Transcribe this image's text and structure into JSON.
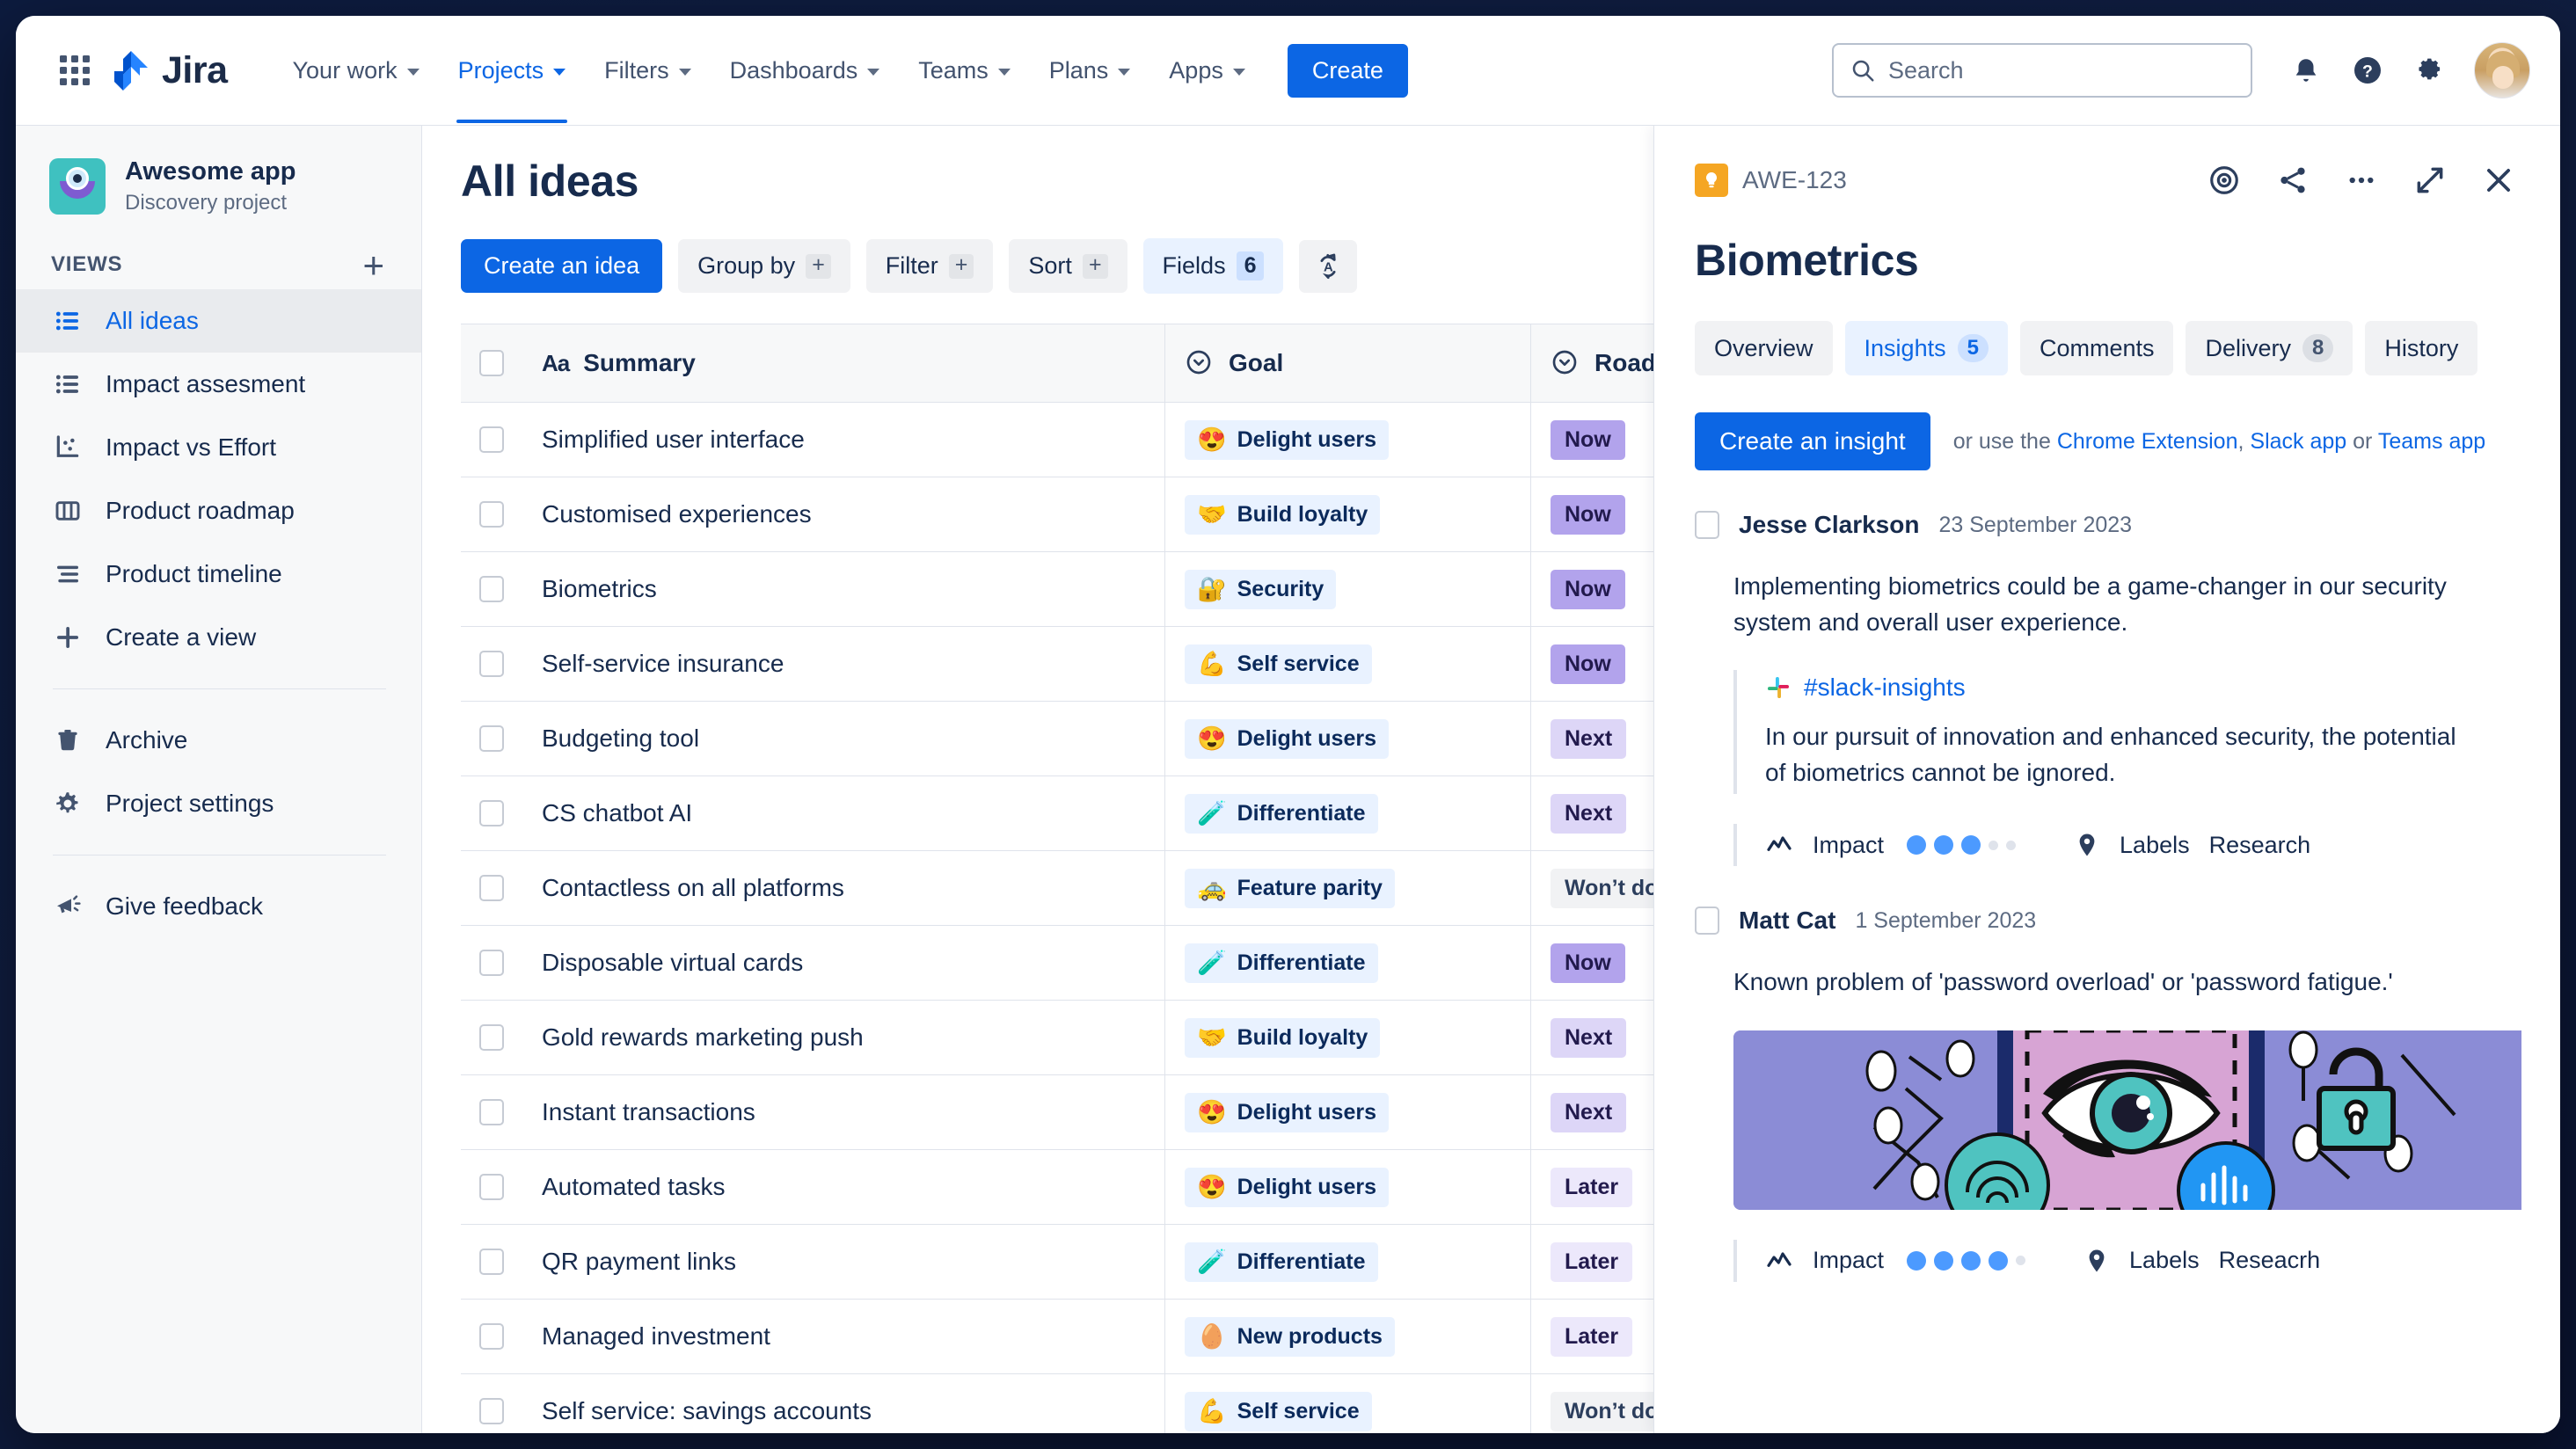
{
  "topnav": {
    "brand": "Jira",
    "app_switcher_name": "apps-grid-icon",
    "items": [
      {
        "label": "Your work",
        "active": false
      },
      {
        "label": "Projects",
        "active": true
      },
      {
        "label": "Filters",
        "active": false
      },
      {
        "label": "Dashboards",
        "active": false
      },
      {
        "label": "Teams",
        "active": false
      },
      {
        "label": "Plans",
        "active": false
      },
      {
        "label": "Apps",
        "active": false
      }
    ],
    "create_label": "Create",
    "search_placeholder": "Search",
    "icons": [
      "notifications-icon",
      "help-icon",
      "settings-icon",
      "avatar"
    ]
  },
  "sidebar": {
    "project_name": "Awesome app",
    "project_type": "Discovery project",
    "section_label": "VIEWS",
    "add_view_label": "+",
    "views": [
      {
        "label": "All ideas",
        "icon": "list-icon",
        "selected": true
      },
      {
        "label": "Impact assesment",
        "icon": "list-icon",
        "selected": false
      },
      {
        "label": "Impact vs Effort",
        "icon": "scatter-chart-icon",
        "selected": false
      },
      {
        "label": "Product roadmap",
        "icon": "board-columns-icon",
        "selected": false
      },
      {
        "label": "Product timeline",
        "icon": "timeline-icon",
        "selected": false
      },
      {
        "label": "Create a view",
        "icon": "plus-icon",
        "selected": false
      }
    ],
    "secondary": [
      {
        "label": "Archive",
        "icon": "trash-icon"
      },
      {
        "label": "Project settings",
        "icon": "gear-icon"
      }
    ],
    "feedback": {
      "label": "Give feedback",
      "icon": "megaphone-icon"
    }
  },
  "main": {
    "page_title": "All ideas",
    "toolbar": {
      "create_idea": "Create an idea",
      "group_by": "Group by",
      "group_by_plus": "+",
      "filter": "Filter",
      "filter_plus": "+",
      "sort": "Sort",
      "sort_plus": "+",
      "fields": "Fields",
      "fields_count": "6",
      "autosort_icon": "auto-sort-az-icon"
    },
    "table": {
      "columns": [
        {
          "label": "Summary",
          "icon": "text-aa-icon"
        },
        {
          "label": "Goal",
          "icon": "select-chevron-circle-icon"
        },
        {
          "label": "Roadm",
          "icon": "select-chevron-circle-icon"
        }
      ],
      "rows": [
        {
          "summary": "Simplified user interface",
          "goal": "Delight users",
          "goal_emoji": "😍",
          "roadmap": "Now",
          "roadmap_style": "now"
        },
        {
          "summary": "Customised experiences",
          "goal": "Build loyalty",
          "goal_emoji": "🤝",
          "roadmap": "Now",
          "roadmap_style": "now"
        },
        {
          "summary": "Biometrics",
          "goal": "Security",
          "goal_emoji": "🔐",
          "roadmap": "Now",
          "roadmap_style": "now"
        },
        {
          "summary": "Self-service insurance",
          "goal": "Self service",
          "goal_emoji": "💪",
          "roadmap": "Now",
          "roadmap_style": "now"
        },
        {
          "summary": "Budgeting tool",
          "goal": "Delight users",
          "goal_emoji": "😍",
          "roadmap": "Next",
          "roadmap_style": "next"
        },
        {
          "summary": "CS chatbot AI",
          "goal": "Differentiate",
          "goal_emoji": "🧪",
          "roadmap": "Next",
          "roadmap_style": "next"
        },
        {
          "summary": "Contactless on all platforms",
          "goal": "Feature parity",
          "goal_emoji": "🚕",
          "roadmap": "Won’t do",
          "roadmap_style": "wont"
        },
        {
          "summary": "Disposable virtual cards",
          "goal": "Differentiate",
          "goal_emoji": "🧪",
          "roadmap": "Now",
          "roadmap_style": "now"
        },
        {
          "summary": "Gold rewards marketing push",
          "goal": "Build loyalty",
          "goal_emoji": "🤝",
          "roadmap": "Next",
          "roadmap_style": "next"
        },
        {
          "summary": "Instant transactions",
          "goal": "Delight users",
          "goal_emoji": "😍",
          "roadmap": "Next",
          "roadmap_style": "next"
        },
        {
          "summary": "Automated tasks",
          "goal": "Delight users",
          "goal_emoji": "😍",
          "roadmap": "Later",
          "roadmap_style": "later"
        },
        {
          "summary": "QR payment links",
          "goal": "Differentiate",
          "goal_emoji": "🧪",
          "roadmap": "Later",
          "roadmap_style": "later"
        },
        {
          "summary": "Managed investment",
          "goal": "New products",
          "goal_emoji": "🥚",
          "roadmap": "Later",
          "roadmap_style": "later"
        },
        {
          "summary": "Self service: savings accounts",
          "goal": "Self service",
          "goal_emoji": "💪",
          "roadmap": "Won’t do",
          "roadmap_style": "wont"
        }
      ]
    }
  },
  "panel": {
    "issue_key": "AWE-123",
    "title": "Biometrics",
    "actions": [
      "watch-eye-icon",
      "share-icon",
      "more-options-icon",
      "expand-icon",
      "close-icon"
    ],
    "tabs": [
      {
        "label": "Overview",
        "count": null,
        "active": false
      },
      {
        "label": "Insights",
        "count": "5",
        "active": true
      },
      {
        "label": "Comments",
        "count": null,
        "active": false
      },
      {
        "label": "Delivery",
        "count": "8",
        "active": false
      },
      {
        "label": "History",
        "count": null,
        "active": false
      }
    ],
    "create_insight": "Create an insight",
    "hint_prefix": "or use the ",
    "hint_links": [
      "Chrome Extension",
      "Slack app",
      "Teams app"
    ],
    "hint_sep1": ", ",
    "hint_sep2": " or ",
    "insights": [
      {
        "author": "Jesse Clarkson",
        "date": "23 September 2023",
        "body": "Implementing biometrics could be a game-changer in our security system and overall user experience.",
        "quote_channel": "#slack-insights",
        "quote_icon": "slack-icon",
        "quote_text": "In our pursuit of innovation and enhanced security, the potential of biometrics cannot be ignored.",
        "impact_label": "Impact",
        "impact_filled": 3,
        "impact_total": 5,
        "labels_label": "Labels",
        "label_value": "Research",
        "impact_icon": "trend-line-icon",
        "labels_icon": "tag-icon"
      },
      {
        "author": "Matt Cat",
        "date": "1 September 2023",
        "body": "Known problem of 'password overload' or 'password fatigue.'",
        "has_image": true,
        "image_alt": "biometrics-illustration",
        "impact_label": "Impact",
        "impact_filled": 4,
        "impact_total": 5,
        "labels_label": "Labels",
        "label_value": "Reseacrh",
        "impact_icon": "trend-line-icon",
        "labels_icon": "tag-icon"
      }
    ]
  },
  "colors": {
    "brand_blue": "#0c66e4",
    "text": "#172b4d",
    "muted": "#5d6b82",
    "chip_bg": "#e9f2ff",
    "now": "#b2a3ec",
    "next": "#ddd6f7",
    "later": "#ece8fb",
    "wont": "#f1f2f4",
    "key_orange": "#f5a623"
  }
}
